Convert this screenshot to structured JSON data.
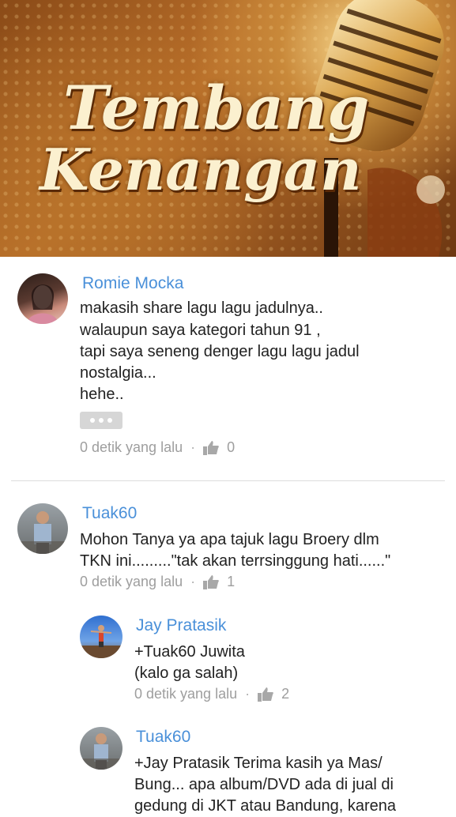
{
  "banner": {
    "title_line1": "Tembang",
    "title_line2": "Kenangan"
  },
  "comments": [
    {
      "author": "Romie Mocka",
      "lines": [
        "makasih share lagu lagu jadulnya..",
        "walaupun saya kategori tahun 91 ,",
        "tapi saya seneng denger lagu lagu jadul",
        "nostalgia...",
        "hehe.."
      ],
      "time": "0 detik yang lalu",
      "likes": "0"
    },
    {
      "author": "Tuak60",
      "lines": [
        "Mohon Tanya ya apa tajuk lagu Broery dlm",
        "TKN ini.........\"tak akan terrsinggung hati......\""
      ],
      "time": "0 detik yang lalu",
      "likes": "1"
    },
    {
      "author": "Jay Pratasik",
      "lines": [
        "+Tuak60 Juwita",
        "(kalo ga salah)"
      ],
      "time": "0 detik yang lalu",
      "likes": "2"
    },
    {
      "author": "Tuak60",
      "lines": [
        "+Jay Pratasik Terima kasih ya Mas/",
        "Bung... apa album/DVD ada di jual di",
        "gedung di JKT atau Bandung, karena"
      ],
      "time": "",
      "likes": ""
    }
  ],
  "icons": {
    "more": "more-dots-icon",
    "like": "thumbs-up-icon"
  },
  "colors": {
    "author": "#4a90d9",
    "text": "#222222",
    "meta": "#9e9e9e"
  }
}
